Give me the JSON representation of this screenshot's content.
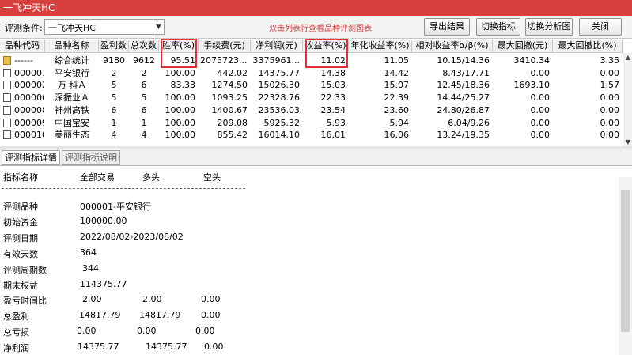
{
  "window": {
    "title": "一飞冲天HC"
  },
  "toolbar": {
    "condition_label": "评测条件:",
    "condition_value": "一飞冲天HC",
    "hint": "双击列表行查看品种评测图表",
    "export_label": "导出结果",
    "switch_indicator_label": "切换指标",
    "switch_chart_label": "切换分析图",
    "close_label": "关闭"
  },
  "grid": {
    "columns": [
      "品种代码",
      "品种名称",
      "盈利数",
      "总次数",
      "胜率(%)",
      "手续费(元)",
      "净利润(元)",
      "收益率(%)",
      "年化收益率(%)",
      "相对收益率α/β(%)",
      "最大回撤(元)",
      "最大回撤比(%)"
    ],
    "rows": [
      {
        "code": "------",
        "name": "综合统计",
        "wins": "9180",
        "total": "9612",
        "winrate": "95.51",
        "fee": "2075723....",
        "net": "3375961...",
        "ret": "11.02",
        "annual": "11.05",
        "relative": "10.15/14.36",
        "maxdd": "3410.34",
        "maxddr": "3.35",
        "icon": "folder-icon"
      },
      {
        "code": "000001",
        "name": "平安银行",
        "wins": "2",
        "total": "2",
        "winrate": "100.00",
        "fee": "442.02",
        "net": "14375.77",
        "ret": "14.38",
        "annual": "14.42",
        "relative": "8.43/17.71",
        "maxdd": "0.00",
        "maxddr": "0.00",
        "icon": "document-icon"
      },
      {
        "code": "000002",
        "name": "万 科Ａ",
        "wins": "5",
        "total": "6",
        "winrate": "83.33",
        "fee": "1274.50",
        "net": "15026.30",
        "ret": "15.03",
        "annual": "15.07",
        "relative": "12.45/18.36",
        "maxdd": "1693.10",
        "maxddr": "1.57",
        "icon": "document-icon"
      },
      {
        "code": "000006",
        "name": "深振业Ａ",
        "wins": "5",
        "total": "5",
        "winrate": "100.00",
        "fee": "1093.25",
        "net": "22328.76",
        "ret": "22.33",
        "annual": "22.39",
        "relative": "14.44/25.27",
        "maxdd": "0.00",
        "maxddr": "0.00",
        "icon": "document-icon"
      },
      {
        "code": "000008",
        "name": "神州高铁",
        "wins": "6",
        "total": "6",
        "winrate": "100.00",
        "fee": "1400.67",
        "net": "23536.03",
        "ret": "23.54",
        "annual": "23.60",
        "relative": "24.80/26.87",
        "maxdd": "0.00",
        "maxddr": "0.00",
        "icon": "document-icon"
      },
      {
        "code": "000009",
        "name": "中国宝安",
        "wins": "1",
        "total": "1",
        "winrate": "100.00",
        "fee": "209.08",
        "net": "5925.32",
        "ret": "5.93",
        "annual": "5.94",
        "relative": "6.04/9.26",
        "maxdd": "0.00",
        "maxddr": "0.00",
        "icon": "document-icon"
      },
      {
        "code": "000010",
        "name": "美丽生态",
        "wins": "4",
        "total": "4",
        "winrate": "100.00",
        "fee": "855.42",
        "net": "16014.10",
        "ret": "16.01",
        "annual": "16.06",
        "relative": "13.24/19.35",
        "maxdd": "0.00",
        "maxddr": "0.00",
        "icon": "document-icon"
      }
    ]
  },
  "tabs": [
    {
      "label": "评测指标详情",
      "active": true
    },
    {
      "label": "评测指标说明",
      "active": false
    }
  ],
  "detail": {
    "header": {
      "c1": "指标名称",
      "c2": "全部交易",
      "c3": "多头",
      "c4": "空头"
    },
    "lines": [
      {
        "label": "评测品种",
        "v1": "000001-平安银行",
        "v2": "",
        "v3": ""
      },
      {
        "label": "初始资金",
        "v1": "100000.00",
        "v2": "",
        "v3": ""
      },
      {
        "label": "评测日期",
        "v1": "2022/08/02-2023/08/02",
        "v2": "",
        "v3": ""
      },
      {
        "label": "有效天数",
        "v1": "364",
        "v2": "",
        "v3": ""
      },
      {
        "label": "评测周期数",
        "v1": "344",
        "v2": "",
        "v3": ""
      },
      {
        "label": "期末权益",
        "v1": "114375.77",
        "v2": "",
        "v3": ""
      },
      {
        "label": "盈亏时间比",
        "v1": "2.00",
        "v2": "2.00",
        "v3": "0.00"
      },
      {
        "label": "总盈利",
        "v1": "14817.79",
        "v2": "14817.79",
        "v3": "0.00"
      },
      {
        "label": "总亏损",
        "v1": "0.00",
        "v2": "0.00",
        "v3": "0.00"
      },
      {
        "label": "净利润",
        "v1": "14375.77",
        "v2": "14375.77",
        "v3": "0.00"
      }
    ]
  },
  "colors": {
    "titlebar": "#d7403e",
    "highlight_box": "#e03030",
    "hint_text": "#d23a3a"
  }
}
